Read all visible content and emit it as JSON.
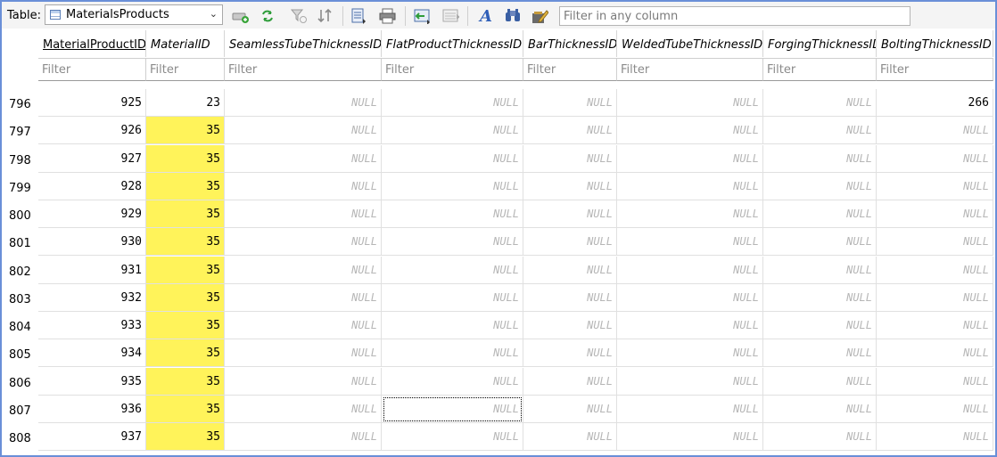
{
  "toolbar": {
    "table_label": "Table:",
    "selected_table": "MaterialsProducts",
    "filter_placeholder": "Filter in any column"
  },
  "grid": {
    "columns": [
      "MaterialProductID",
      "MaterialID",
      "SeamlessTubeThicknessID",
      "FlatProductThicknessID",
      "BarThicknessID",
      "WeldedTubeThicknessID",
      "ForgingThicknessID",
      "BoltingThicknessID"
    ],
    "filter_placeholder": "Filter",
    "null_text": "NULL",
    "highlight_color": "#fff35a",
    "rows": [
      {
        "num": "796",
        "cells": [
          "925",
          "23",
          "NULL",
          "NULL",
          "NULL",
          "NULL",
          "NULL",
          "266"
        ]
      },
      {
        "num": "797",
        "cells": [
          "926",
          "35",
          "NULL",
          "NULL",
          "NULL",
          "NULL",
          "NULL",
          "NULL"
        ]
      },
      {
        "num": "798",
        "cells": [
          "927",
          "35",
          "NULL",
          "NULL",
          "NULL",
          "NULL",
          "NULL",
          "NULL"
        ]
      },
      {
        "num": "799",
        "cells": [
          "928",
          "35",
          "NULL",
          "NULL",
          "NULL",
          "NULL",
          "NULL",
          "NULL"
        ]
      },
      {
        "num": "800",
        "cells": [
          "929",
          "35",
          "NULL",
          "NULL",
          "NULL",
          "NULL",
          "NULL",
          "NULL"
        ]
      },
      {
        "num": "801",
        "cells": [
          "930",
          "35",
          "NULL",
          "NULL",
          "NULL",
          "NULL",
          "NULL",
          "NULL"
        ]
      },
      {
        "num": "802",
        "cells": [
          "931",
          "35",
          "NULL",
          "NULL",
          "NULL",
          "NULL",
          "NULL",
          "NULL"
        ]
      },
      {
        "num": "803",
        "cells": [
          "932",
          "35",
          "NULL",
          "NULL",
          "NULL",
          "NULL",
          "NULL",
          "NULL"
        ]
      },
      {
        "num": "804",
        "cells": [
          "933",
          "35",
          "NULL",
          "NULL",
          "NULL",
          "NULL",
          "NULL",
          "NULL"
        ]
      },
      {
        "num": "805",
        "cells": [
          "934",
          "35",
          "NULL",
          "NULL",
          "NULL",
          "NULL",
          "NULL",
          "NULL"
        ]
      },
      {
        "num": "806",
        "cells": [
          "935",
          "35",
          "NULL",
          "NULL",
          "NULL",
          "NULL",
          "NULL",
          "NULL"
        ]
      },
      {
        "num": "807",
        "cells": [
          "936",
          "35",
          "NULL",
          "NULL",
          "NULL",
          "NULL",
          "NULL",
          "NULL"
        ]
      },
      {
        "num": "808",
        "cells": [
          "937",
          "35",
          "NULL",
          "NULL",
          "NULL",
          "NULL",
          "NULL",
          "NULL"
        ]
      }
    ]
  }
}
